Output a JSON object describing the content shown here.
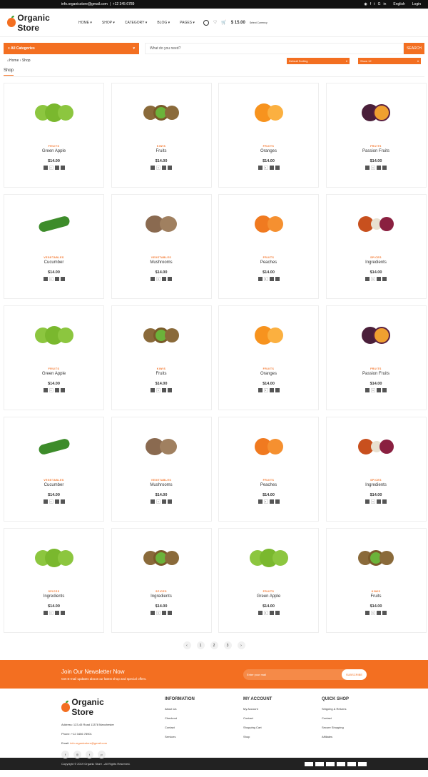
{
  "top": {
    "email": "info.organicstore@gmail.com",
    "phone": "+12 345 6789",
    "lang": "English",
    "login": "Login"
  },
  "brand": "Organic Store",
  "nav": [
    "HOME",
    "SHOP",
    "CATEGORY",
    "BLOG",
    "PAGES"
  ],
  "cart": {
    "amount": "$ 15.00",
    "sub": "Select Currency"
  },
  "search": {
    "category": "All Categories",
    "placeholder": "What do you need?",
    "button": "SEARCH"
  },
  "breadcrumb": {
    "home": "Home",
    "current": "Shop"
  },
  "sort": {
    "sorting": "Default Sorting",
    "show": "Show 12"
  },
  "section_title": "Shop",
  "products": [
    {
      "cat": "FRUITS",
      "name": "Green Apple",
      "price": "$14.00",
      "img": "apple"
    },
    {
      "cat": "KIWIS",
      "name": "Fruits",
      "price": "$14.00",
      "img": "kiwi"
    },
    {
      "cat": "FRUITS",
      "name": "Oranges",
      "price": "$14.00",
      "img": "orange"
    },
    {
      "cat": "FRUITS",
      "name": "Passion Fruits",
      "price": "$14.00",
      "img": "passion"
    },
    {
      "cat": "VEGETABLES",
      "name": "Cucumber",
      "price": "$14.00",
      "img": "cucumber"
    },
    {
      "cat": "VEGETABLES",
      "name": "Mushrooms",
      "price": "$14.00",
      "img": "mushroom"
    },
    {
      "cat": "FRUITS",
      "name": "Peaches",
      "price": "$14.00",
      "img": "peach"
    },
    {
      "cat": "SPICES",
      "name": "Ingredients",
      "price": "$14.00",
      "img": "onion"
    },
    {
      "cat": "FRUITS",
      "name": "Green Apple",
      "price": "$14.00",
      "img": "apple"
    },
    {
      "cat": "KIWIS",
      "name": "Fruits",
      "price": "$14.00",
      "img": "kiwi"
    },
    {
      "cat": "FRUITS",
      "name": "Oranges",
      "price": "$14.00",
      "img": "orange"
    },
    {
      "cat": "FRUITS",
      "name": "Passion Fruits",
      "price": "$14.00",
      "img": "passion"
    },
    {
      "cat": "VEGETABLES",
      "name": "Cucumber",
      "price": "$14.00",
      "img": "cucumber"
    },
    {
      "cat": "VEGETABLES",
      "name": "Mushrooms",
      "price": "$14.00",
      "img": "mushroom"
    },
    {
      "cat": "FRUITS",
      "name": "Peaches",
      "price": "$14.00",
      "img": "peach"
    },
    {
      "cat": "SPICES",
      "name": "Ingredients",
      "price": "$14.00",
      "img": "onion"
    },
    {
      "cat": "SPICES",
      "name": "Ingredients",
      "price": "$14.00",
      "img": "apple"
    },
    {
      "cat": "SPICES",
      "name": "Ingredients",
      "price": "$14.00",
      "img": "kiwi"
    },
    {
      "cat": "FRUITS",
      "name": "Green Apple",
      "price": "$14.00",
      "img": "apple"
    },
    {
      "cat": "KIWIS",
      "name": "Fruits",
      "price": "$14.00",
      "img": "kiwi"
    }
  ],
  "pagination": [
    "‹",
    "1",
    "2",
    "3",
    "›"
  ],
  "newsletter": {
    "title": "Join Our Newsletter Now",
    "text": "Get E-mail updates about our latest shop and special offers.",
    "placeholder": "Enter your mail",
    "button": "SUBSCRIBE"
  },
  "footer": {
    "address": "Address: 123-45 Road 11378 Manchester",
    "phone": "Phone: +12 3456 78901",
    "email_label": "Email:",
    "email": "info.organicstore@gmail.com",
    "info": {
      "title": "INFORMATION",
      "links": [
        "About Us",
        "Checkout",
        "Contact",
        "Services"
      ]
    },
    "account": {
      "title": "MY ACCOUNT",
      "links": [
        "My Account",
        "Contact",
        "Shopping Cart",
        "Shop"
      ]
    },
    "quick": {
      "title": "QUICK SHOP",
      "links": [
        "Shipping & Returns",
        "Contact",
        "Secure Shopping",
        "Affiliates"
      ]
    }
  },
  "copyright": "Copyright © 2019 Organic Store - All Rights Reserved.",
  "colors": {
    "accent": "#f36f21"
  }
}
